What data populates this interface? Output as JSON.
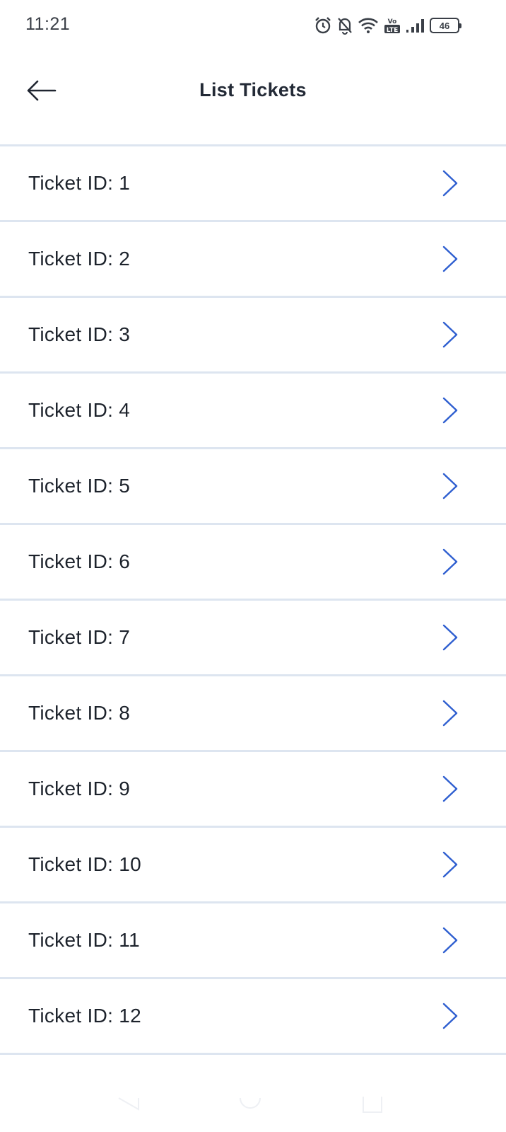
{
  "status_bar": {
    "time": "11:21",
    "battery": "46",
    "network_badge": "LTE",
    "icons": [
      "alarm-icon",
      "bell-off-icon",
      "wifi-icon",
      "volte-icon",
      "signal-icon",
      "battery-icon"
    ]
  },
  "header": {
    "title": "List Tickets",
    "back_icon": "arrow-left-icon"
  },
  "tickets": [
    {
      "label": "Ticket ID: 1"
    },
    {
      "label": "Ticket ID: 2"
    },
    {
      "label": "Ticket ID: 3"
    },
    {
      "label": "Ticket ID: 4"
    },
    {
      "label": "Ticket ID: 5"
    },
    {
      "label": "Ticket ID: 6"
    },
    {
      "label": "Ticket ID: 7"
    },
    {
      "label": "Ticket ID: 8"
    },
    {
      "label": "Ticket ID: 9"
    },
    {
      "label": "Ticket ID: 10"
    },
    {
      "label": "Ticket ID: 11"
    },
    {
      "label": "Ticket ID: 12"
    }
  ],
  "colors": {
    "accent": "#2f5fd0",
    "divider": "#dde5f0",
    "text": "#1c222b"
  },
  "nav_bar": {
    "icons": [
      "nav-back-icon",
      "nav-home-icon",
      "nav-recents-icon"
    ]
  }
}
